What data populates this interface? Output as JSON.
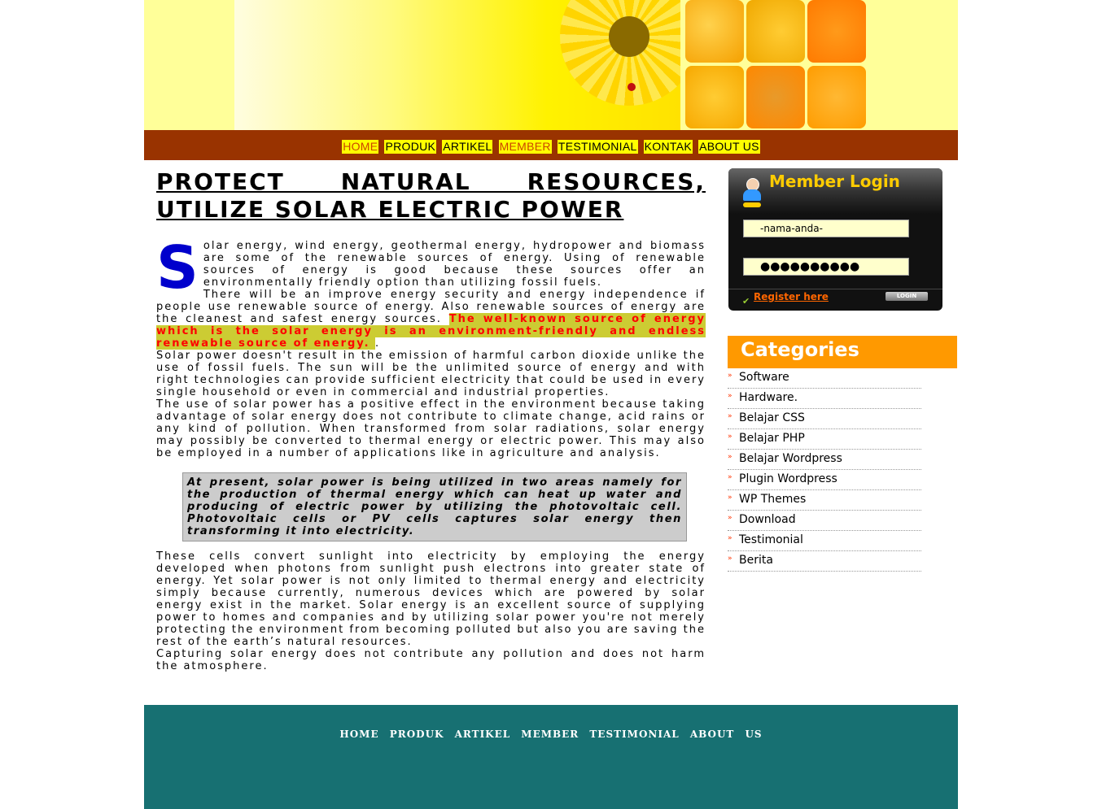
{
  "nav": [
    {
      "label": "HOME"
    },
    {
      "label": "PRODUK"
    },
    {
      "label": "ARTIKEL"
    },
    {
      "label": "MEMBER"
    },
    {
      "label": "TESTIMONIAL"
    },
    {
      "label": "KONTAK"
    },
    {
      "label": "ABOUT US"
    }
  ],
  "article": {
    "title": "PROTECT NATURAL RESOURCES, UTILIZE SOLAR ELECTRIC POWER",
    "dropcap": "S",
    "p1_rest": "olar energy, wind energy, geothermal energy, hydropower and biomass are some of the renewable sources of energy. Using of renewable sources of energy is good because these sources offer an environmentally friendly option than utilizing fossil fuels.",
    "p2": "There will be an improve energy security and energy independence if people use renewable source of energy. Also renewable sources of energy are the cleanest and safest energy sources. ",
    "p2_highlight": "The well-known source of energy which is the solar energy is an environment-friendly and endless renewable source of energy. ",
    "p2_end": ".",
    "p3": "Solar power doesn't result in the emission of harmful carbon dioxide unlike the use of fossil fuels. The sun will be the unlimited source of energy and with right technologies can provide sufficient electricity that could be used in every single household or even in commercial and industrial properties.",
    "p4": "The use of solar power has a positive effect in the environment because taking advantage of solar energy does not contribute to climate change, acid rains or any kind of pollution. When transformed from solar radiations, solar energy may possibly be converted to thermal energy or electric power. This may also be employed in a number of applications like in agriculture and analysis.",
    "quote": "At present, solar power is being utilized in two areas namely for the production of thermal energy which can heat up water and producing of electric power by utilizing the photovoltaic cell. Photovoltaic cells or PV cells captures solar energy then transforming it into electricity.",
    "p5": "These cells convert sunlight into electricity by employing the energy developed when photons from sunlight push electrons into greater state of energy. Yet solar power is not only limited to thermal energy and electricity simply because currently, numerous devices which are powered by solar energy exist in the market. Solar energy is an excellent source of supplying power to homes and companies and by utilizing solar power you're not merely protecting the environment from becoming polluted but also you are saving the rest of the earth’s natural resources.",
    "p6": "Capturing solar energy does not contribute any pollution and does not harm the atmosphere."
  },
  "login": {
    "title": "Member Login",
    "username_value": "-nama-anda-",
    "password_value": "●●●●●●●●●●",
    "register_label": "Register here",
    "button_label": "LOGIN"
  },
  "categories": {
    "title": "Categories",
    "items": [
      "Software",
      "Hardware.",
      "Belajar CSS",
      "Belajar PHP",
      "Belajar Wordpress",
      "Plugin Wordpress",
      "WP Themes",
      "Download",
      "Testimonial",
      "Berita"
    ]
  },
  "footer_nav": [
    "HOME",
    "PRODUK",
    "ARTIKEL",
    "MEMBER",
    "TESTIMONIAL",
    "ABOUT",
    "US"
  ],
  "colors": {
    "nav_bar": "#993300",
    "nav_item_bg": "#ffff00",
    "header_bg": "#ffff99",
    "footer_bg": "#177072",
    "categories_head": "#ff9900",
    "dropcap": "#0000cc",
    "highlight_text": "#ff0000",
    "highlight_bg": "#cccc33"
  }
}
